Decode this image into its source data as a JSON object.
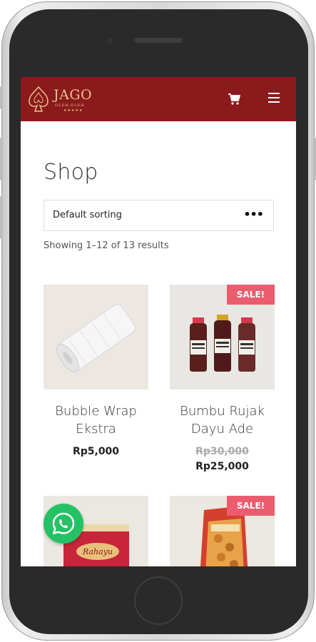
{
  "header": {
    "logo_text": "JAGO",
    "logo_sub": "OLEH-OLEH",
    "logo_stars": "★★★★★",
    "brand_color": "#8b1a1d",
    "cart_icon": "cart-icon",
    "menu_icon": "hamburger-menu-icon"
  },
  "main": {
    "title": "Shop",
    "sorting": {
      "selected": "Default sorting"
    },
    "result_count": "Showing 1–12 of 13 results"
  },
  "products": [
    {
      "name": "Bubble Wrap Ekstra",
      "price": "Rp5,000",
      "sale": false
    },
    {
      "name": "Bumbu Rujak Dayu Ade",
      "old_price": "Rp30,000",
      "price": "Rp25,000",
      "sale": true,
      "badge": "SALE!"
    },
    {
      "name": "",
      "sale": false
    },
    {
      "name": "",
      "sale": true,
      "badge": "SALE!"
    }
  ],
  "floating": {
    "whatsapp_icon": "whatsapp-icon",
    "color": "#25c165"
  }
}
